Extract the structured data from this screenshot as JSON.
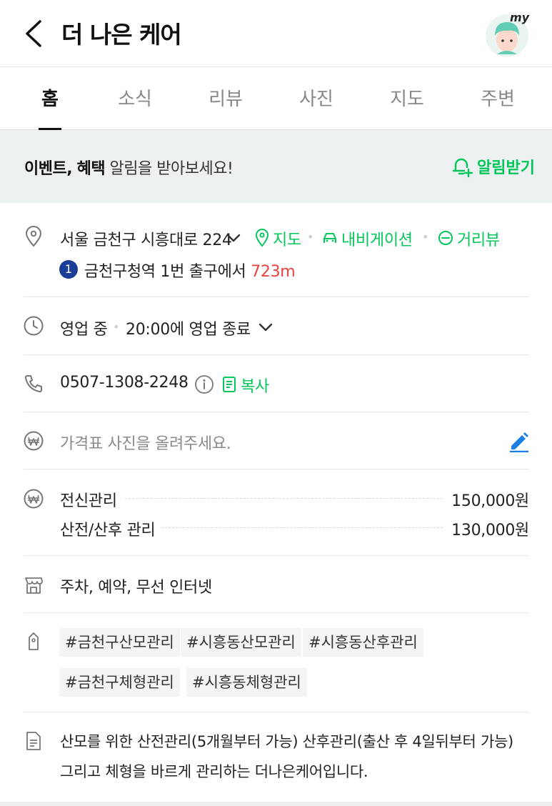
{
  "header": {
    "title": "더 나은 케어",
    "avatar_badge": "my"
  },
  "tabs": [
    {
      "label": "홈",
      "active": true
    },
    {
      "label": "소식"
    },
    {
      "label": "리뷰"
    },
    {
      "label": "사진"
    },
    {
      "label": "지도"
    },
    {
      "label": "주변"
    }
  ],
  "banner": {
    "bold1": "이벤트,",
    "bold2": "혜택",
    "text": " 알림을 받아보세요!",
    "button": "알림받기"
  },
  "address": {
    "text": "서울 금천구 시흥대로 224",
    "map": "지도",
    "navigation": "내비게이션",
    "street_view": "거리뷰",
    "subway_line": "1",
    "subway_text": "금천구청역 1번 출구에서",
    "distance": "723m"
  },
  "hours": {
    "status": "영업 중",
    "detail": "20:00에 영업 종료"
  },
  "phone": {
    "number": "0507-1308-2248",
    "copy": "복사"
  },
  "price_photo": {
    "placeholder": "가격표 사진을 올려주세요."
  },
  "prices": [
    {
      "name": "전신관리",
      "price": "150,000원"
    },
    {
      "name": "산전/산후 관리",
      "price": "130,000원"
    }
  ],
  "amenities": "주차, 예약, 무선 인터넷",
  "tags": [
    "#금천구산모관리",
    "#시흥동산모관리",
    "#시흥동산후관리",
    "#금천구체형관리",
    "#시흥동체형관리"
  ],
  "description": {
    "line1": "산모를 위한 산전관리(5개월부터 가능) 산후관리(출산 후 4일뒤부터 가능)",
    "line2": "그리고 체형을 바르게 관리하는 더나은케어입니다."
  },
  "colors": {
    "accent": "#03c75a",
    "distance": "#e5443f",
    "subway_line1": "#1b3d95",
    "edit": "#1b7fe3"
  }
}
